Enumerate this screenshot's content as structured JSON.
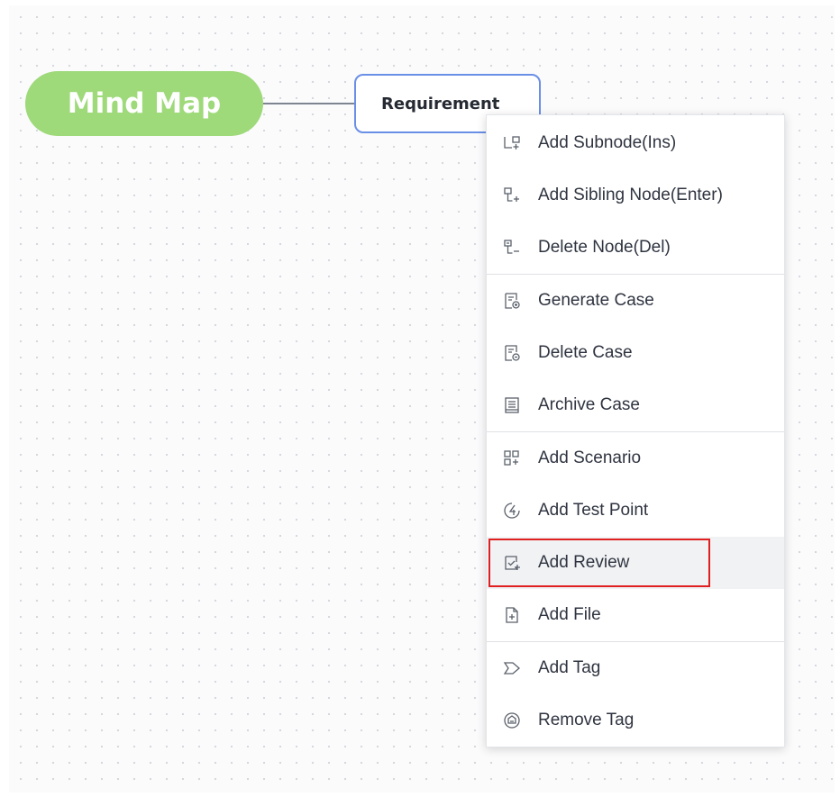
{
  "canvas": {
    "root_node": {
      "label": "Mind Map",
      "color": "#9ed97a"
    },
    "child_node": {
      "label": "Requirement",
      "border_color": "#6a8fe6"
    }
  },
  "context_menu": {
    "groups": [
      [
        {
          "label": "Add Subnode(Ins)",
          "icon": "add-subnode-icon"
        },
        {
          "label": "Add Sibling Node(Enter)",
          "icon": "add-sibling-node-icon"
        },
        {
          "label": "Delete Node(Del)",
          "icon": "delete-node-icon"
        }
      ],
      [
        {
          "label": "Generate Case",
          "icon": "generate-case-icon"
        },
        {
          "label": "Delete Case",
          "icon": "delete-case-icon"
        },
        {
          "label": "Archive Case",
          "icon": "archive-case-icon"
        }
      ],
      [
        {
          "label": "Add Scenario",
          "icon": "add-scenario-icon"
        },
        {
          "label": "Add Test Point",
          "icon": "add-test-point-icon"
        },
        {
          "label": "Add Review",
          "icon": "add-review-icon",
          "highlighted": true
        },
        {
          "label": "Add File",
          "icon": "add-file-icon"
        }
      ],
      [
        {
          "label": "Add Tag",
          "icon": "add-tag-icon"
        },
        {
          "label": "Remove Tag",
          "icon": "remove-tag-icon"
        }
      ]
    ],
    "highlight_color": "#e02020"
  }
}
